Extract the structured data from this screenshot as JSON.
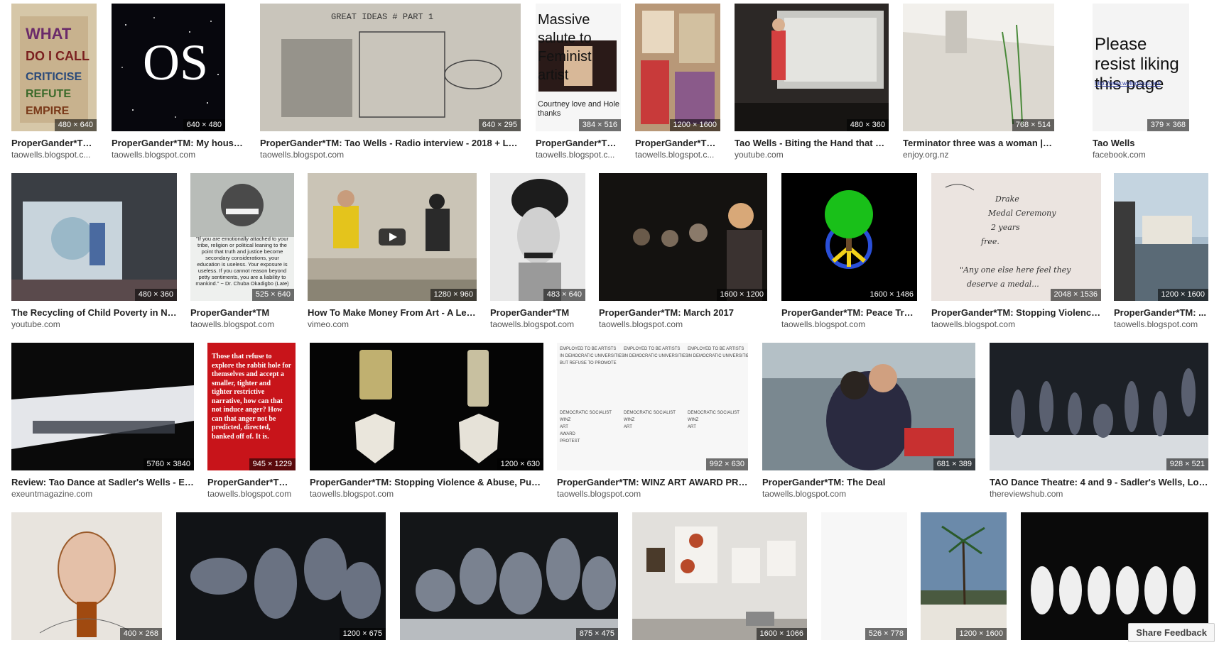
{
  "rows": [
    {
      "id": "row1",
      "items": [
        {
          "dim": "480 × 640",
          "title": "ProperGander*TM...",
          "domain": "taowells.blogspot.c...",
          "tint": "#c9b79a"
        },
        {
          "dim": "640 × 480",
          "title": "ProperGander*TM: My house i...",
          "domain": "taowells.blogspot.com",
          "tint": "#0b0b12",
          "overlay": "OS"
        },
        {
          "dim": "640 × 295",
          "title": "ProperGander*TM: Tao Wells - Radio interview - 2018 + Laun...",
          "domain": "taowells.blogspot.com",
          "tint": "#c4c0b6"
        },
        {
          "dim": "384 × 516",
          "title": "ProperGander*TM...",
          "domain": "taowells.blogspot.c...",
          "tint": "#f2f2f2",
          "overlay": "Massive salute to Feminist artist",
          "caption": "Courtney love and Hole thanks"
        },
        {
          "dim": "1200 × 1600",
          "title": "ProperGander*TM...",
          "domain": "taowells.blogspot.c...",
          "tint": "#a8846a"
        },
        {
          "dim": "480 × 360",
          "title": "Tao Wells - Biting the Hand that Fe...",
          "domain": "youtube.com",
          "tint": "#2a2624"
        },
        {
          "dim": "768 × 514",
          "title": "Terminator three was a woman | Enjoy ...",
          "domain": "enjoy.org.nz",
          "tint": "#d8d4cc"
        },
        {
          "dim": "379 × 368",
          "title": "Tao Wells",
          "domain": "facebook.com",
          "tint": "#f4f4f4",
          "overlay": "Please resist liking this page",
          "caption": "http://www.wellsgroup.net/"
        }
      ]
    },
    {
      "id": "row2",
      "items": [
        {
          "dim": "480 × 360",
          "title": "The Recycling of Child Poverty in Ne...",
          "domain": "youtube.com",
          "tint": "#3c4a52"
        },
        {
          "dim": "525 × 640",
          "title": "ProperGander*TM",
          "domain": "taowells.blogspot.com",
          "tint": "#e8ece8",
          "caption": "\"If you are emotionally attached to your tribe, religion or political leaning to the point that truth and justice become secondary considerations, your education is useless. Your exposure is useless. If you cannot reason beyond petty sentiments, you are a liability to mankind.\" ~ Dr. Chuba Okadigbo (Late)"
        },
        {
          "dim": "1280 × 960",
          "title": "How To Make Money From Art - A Lec...",
          "domain": "vimeo.com",
          "tint": "#8a8676"
        },
        {
          "dim": "483 × 640",
          "title": "ProperGander*TM",
          "domain": "taowells.blogspot.com",
          "tint": "#cfcfcf"
        },
        {
          "dim": "1600 × 1200",
          "title": "ProperGander*TM: March 2017",
          "domain": "taowells.blogspot.com",
          "tint": "#1e1a18"
        },
        {
          "dim": "1600 × 1486",
          "title": "ProperGander*TM: Peace Tree...",
          "domain": "taowells.blogspot.com",
          "tint": "#000000"
        },
        {
          "dim": "2048 × 1536",
          "title": "ProperGander*TM: Stopping Violence ...",
          "domain": "taowells.blogspot.com",
          "tint": "#ece6e2"
        },
        {
          "dim": "1200 × 1600",
          "title": "ProperGander*TM: ...",
          "domain": "taowells.blogspot.com",
          "tint": "#9aa8b2"
        }
      ]
    },
    {
      "id": "row3",
      "items": [
        {
          "dim": "5760 × 3840",
          "title": "Review: Tao Dance at Sadler's Wells - Exe...",
          "domain": "exeuntmagazine.com",
          "tint": "#101010"
        },
        {
          "dim": "945 × 1229",
          "title": "ProperGander*TM:...",
          "domain": "taowells.blogspot.com",
          "tint": "#c8141a",
          "caption": "Those that refuse to explore the rabbit hole for themselves and accept a smaller, tighter and tighter restrictive narrative, how can that not induce anger? How can that anger not be predicted, directed, banked off of. It is."
        },
        {
          "dim": "1200 × 630",
          "title": "ProperGander*TM: Stopping Violence & Abuse, Publi...",
          "domain": "taowells.blogspot.com",
          "tint": "#050505"
        },
        {
          "dim": "992 × 630",
          "title": "ProperGander*TM: WINZ ART AWARD PRO...",
          "domain": "taowells.blogspot.com",
          "tint": "#f6f6f6"
        },
        {
          "dim": "681 × 389",
          "title": "ProperGander*TM: The Deal",
          "domain": "taowells.blogspot.com",
          "tint": "#5a6870"
        },
        {
          "dim": "928 × 521",
          "title": "TAO Dance Theatre: 4 and 9 - Sadler's Wells, Lon...",
          "domain": "thereviewshub.com",
          "tint": "#262a30"
        }
      ]
    },
    {
      "id": "row4",
      "items": [
        {
          "dim": "400 × 268",
          "title": "",
          "domain": "",
          "tint": "#e6e2dc"
        },
        {
          "dim": "1200 × 675",
          "title": "",
          "domain": "",
          "tint": "#15171a"
        },
        {
          "dim": "875 × 475",
          "title": "",
          "domain": "",
          "tint": "#1a1c20"
        },
        {
          "dim": "1600 × 1066",
          "title": "",
          "domain": "",
          "tint": "#e4e2de"
        },
        {
          "dim": "526 × 778",
          "title": "",
          "domain": "",
          "tint": "#f7f7f7"
        },
        {
          "dim": "1200 × 1600",
          "title": "",
          "domain": "",
          "tint": "#6f8aa6"
        },
        {
          "dim": "",
          "title": "",
          "domain": "",
          "tint": "#0a0a0a"
        }
      ]
    }
  ],
  "feedback_label": "Share Feedback",
  "colors": {
    "caption_text": "#222222",
    "domain_text": "#555555",
    "dim_badge_bg": "rgba(0,0,0,0.55)"
  }
}
